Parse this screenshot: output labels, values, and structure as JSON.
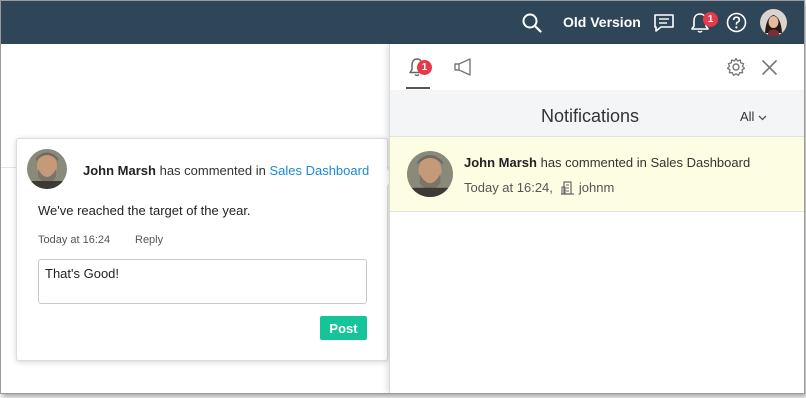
{
  "topbar": {
    "old_version_label": "Old Version",
    "notification_count": "1",
    "icons": [
      "search-icon",
      "feedback-icon",
      "bell-icon",
      "help-icon",
      "user-avatar"
    ]
  },
  "panel": {
    "tab_notifications_count": "1",
    "title": "Notifications",
    "filter": "All",
    "items": [
      {
        "author": "John Marsh",
        "action": "has commented in",
        "target": "Sales Dashboard",
        "time": "Today at 16:24,",
        "user": "johnm"
      }
    ]
  },
  "comment": {
    "author": "John Marsh",
    "action": "has commented in",
    "target": "Sales Dashboard",
    "text": "We've reached the target of the year.",
    "time": "Today at 16:24",
    "reply_label": "Reply",
    "input_value": "That's Good!",
    "post_label": "Post"
  },
  "colors": {
    "topbar": "#2e4658",
    "badge": "#e8394a",
    "link": "#1a8ad8",
    "post_button": "#16c49a",
    "highlight": "#fdfde3"
  }
}
